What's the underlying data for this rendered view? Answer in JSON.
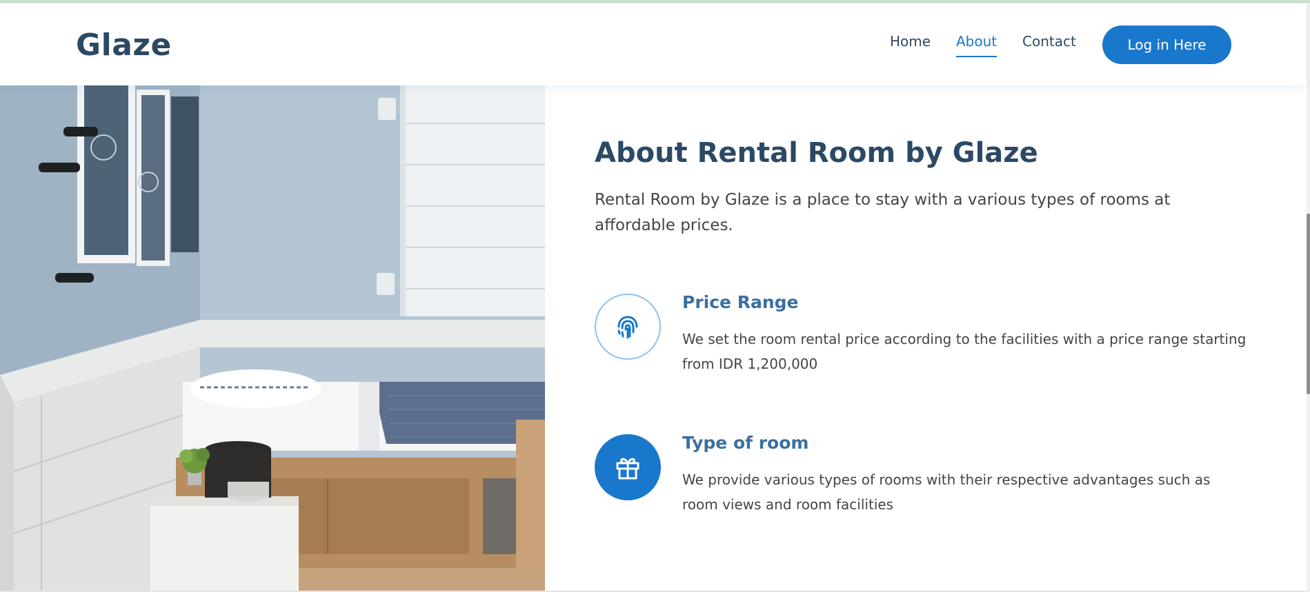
{
  "header": {
    "logo": "Glaze",
    "nav": [
      {
        "label": "Home",
        "active": false
      },
      {
        "label": "About",
        "active": true
      },
      {
        "label": "Contact",
        "active": false
      }
    ],
    "login_label": "Log in Here"
  },
  "about": {
    "title": "About Rental Room by Glaze",
    "intro": "Rental Room by Glaze is a place to stay with a various types of rooms at affordable prices.",
    "features": [
      {
        "icon": "fingerprint-icon",
        "title": "Price Range",
        "description": "We set the room rental price according to the facilities with a price range starting from IDR 1,200,000"
      },
      {
        "icon": "gift-icon",
        "title": "Type of room",
        "description": "We provide various types of rooms with their respective advantages such as room views and room facilities"
      }
    ]
  },
  "image": {
    "subject": "bedroom-photo"
  },
  "colors": {
    "primary": "#1977cc",
    "heading": "#2c4964",
    "feature_title": "#3b6fa0",
    "text": "#444444"
  }
}
